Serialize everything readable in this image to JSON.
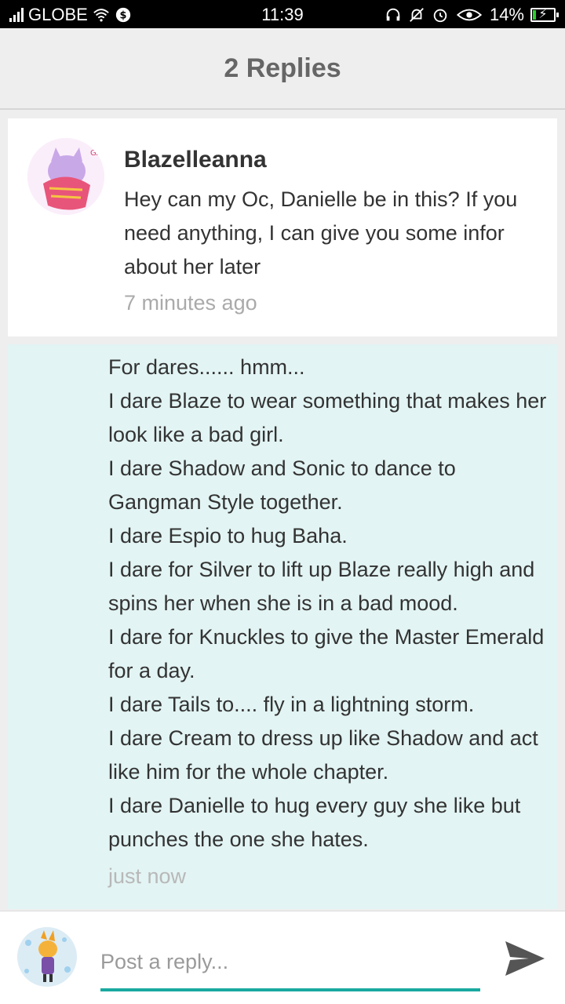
{
  "status_bar": {
    "carrier": "GLOBE",
    "time": "11:39",
    "battery_percent": "14%",
    "battery_level": 0.14
  },
  "header": {
    "title": "2 Replies"
  },
  "reply": {
    "author": "Blazelleanna",
    "body": "Hey can my Oc, Danielle be in this? If you need anything, I can give you some infor about her later",
    "time": "7 minutes ago"
  },
  "my_reply": {
    "lines": [
      "For dares...... hmm...",
      "I dare Blaze to wear something that makes her look like a bad girl.",
      "I dare Shadow and Sonic to dance to Gangman Style together.",
      "I dare Espio to hug Baha.",
      "I dare for Silver to lift up Blaze really high and spins her when she is in a bad mood.",
      "I dare for Knuckles to give the Master Emerald for a day.",
      "I dare Tails to.... fly in a lightning storm.",
      "I dare Cream to dress up like Shadow and act like him for the whole chapter.",
      "I dare Danielle to hug every guy she like but punches the one she hates."
    ],
    "time": "just now"
  },
  "composer": {
    "placeholder": "Post a reply..."
  },
  "colors": {
    "accent": "#19a9a0",
    "own_message_bg": "#e2f4f3",
    "header_bg": "#eeeeee",
    "battery_fill": "#2bd12b"
  },
  "icons": {
    "status": [
      "signal-icon",
      "wifi-icon",
      "data-saver-icon",
      "headphones-icon",
      "mute-bell-icon",
      "alarm-icon",
      "eye-icon",
      "battery-charging-icon"
    ],
    "send": "send-icon"
  }
}
